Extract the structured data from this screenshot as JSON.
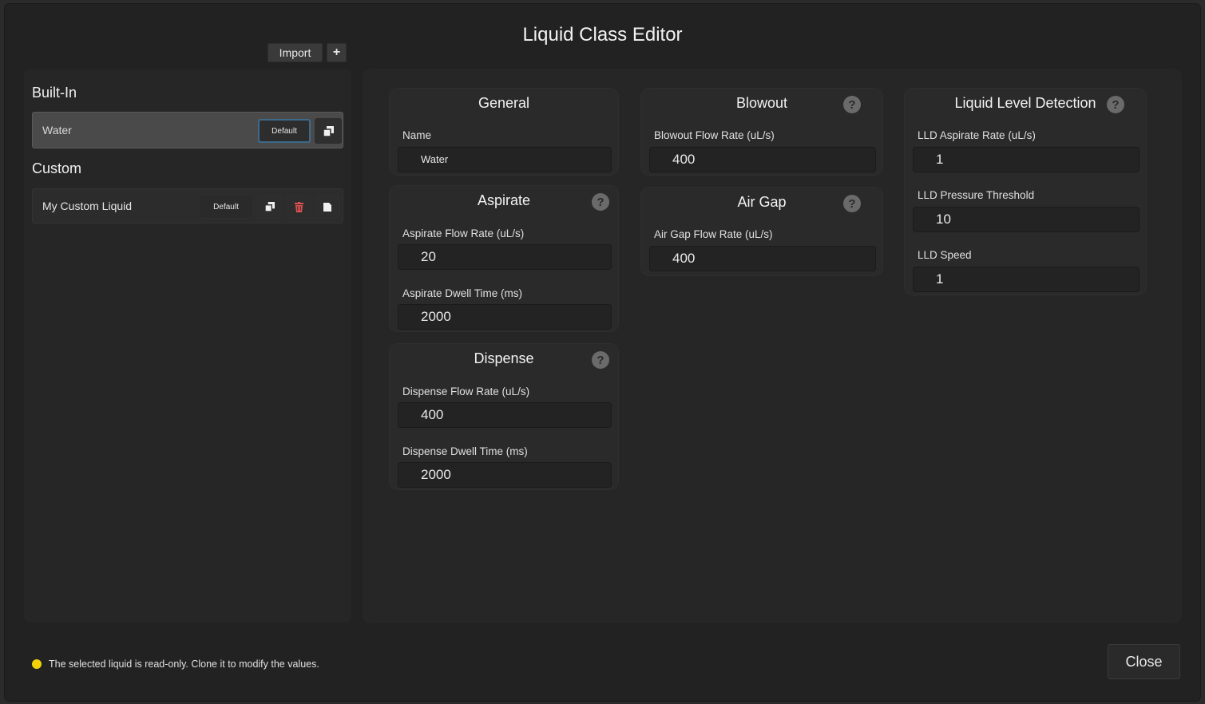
{
  "dialog": {
    "title": "Liquid Class Editor",
    "import_label": "Import",
    "add_label": "+",
    "close_label": "Close"
  },
  "builtin": {
    "heading": "Built-In",
    "items": [
      {
        "name": "Water",
        "default_label": "Default",
        "clone_icon": "clone-icon"
      }
    ]
  },
  "custom": {
    "heading": "Custom",
    "items": [
      {
        "name": "My Custom Liquid",
        "default_label": "Default",
        "clone_icon": "clone-icon",
        "delete_icon": "trash-icon",
        "save_icon": "file-icon"
      }
    ]
  },
  "general": {
    "title": "General",
    "name_label": "Name",
    "name_value": "Water"
  },
  "aspirate": {
    "title": "Aspirate",
    "flow_rate_label": "Aspirate Flow Rate (uL/s)",
    "flow_rate_value": "20",
    "dwell_label": "Aspirate Dwell Time (ms)",
    "dwell_value": "2000"
  },
  "dispense": {
    "title": "Dispense",
    "flow_rate_label": "Dispense Flow Rate (uL/s)",
    "flow_rate_value": "400",
    "dwell_label": "Dispense Dwell Time (ms)",
    "dwell_value": "2000"
  },
  "blowout": {
    "title": "Blowout",
    "flow_rate_label": "Blowout Flow Rate (uL/s)",
    "flow_rate_value": "400"
  },
  "air_gap": {
    "title": "Air Gap",
    "flow_rate_label": "Air Gap Flow Rate (uL/s)",
    "flow_rate_value": "400"
  },
  "lld": {
    "title": "Liquid Level Detection",
    "aspirate_rate_label": "LLD Aspirate Rate (uL/s)",
    "aspirate_rate_value": "1",
    "pressure_label": "LLD Pressure Threshold",
    "pressure_value": "10",
    "speed_label": "LLD Speed",
    "speed_value": "1"
  },
  "help_glyph": "?",
  "status": {
    "message": "The selected liquid is read-only. Clone it to modify the values.",
    "dot_color": "#f2d20a"
  },
  "colors": {
    "background": "#222222",
    "selected_row": "#4a4a4a",
    "default_focus_border": "#3d6a8a",
    "delete": "#e05050"
  }
}
